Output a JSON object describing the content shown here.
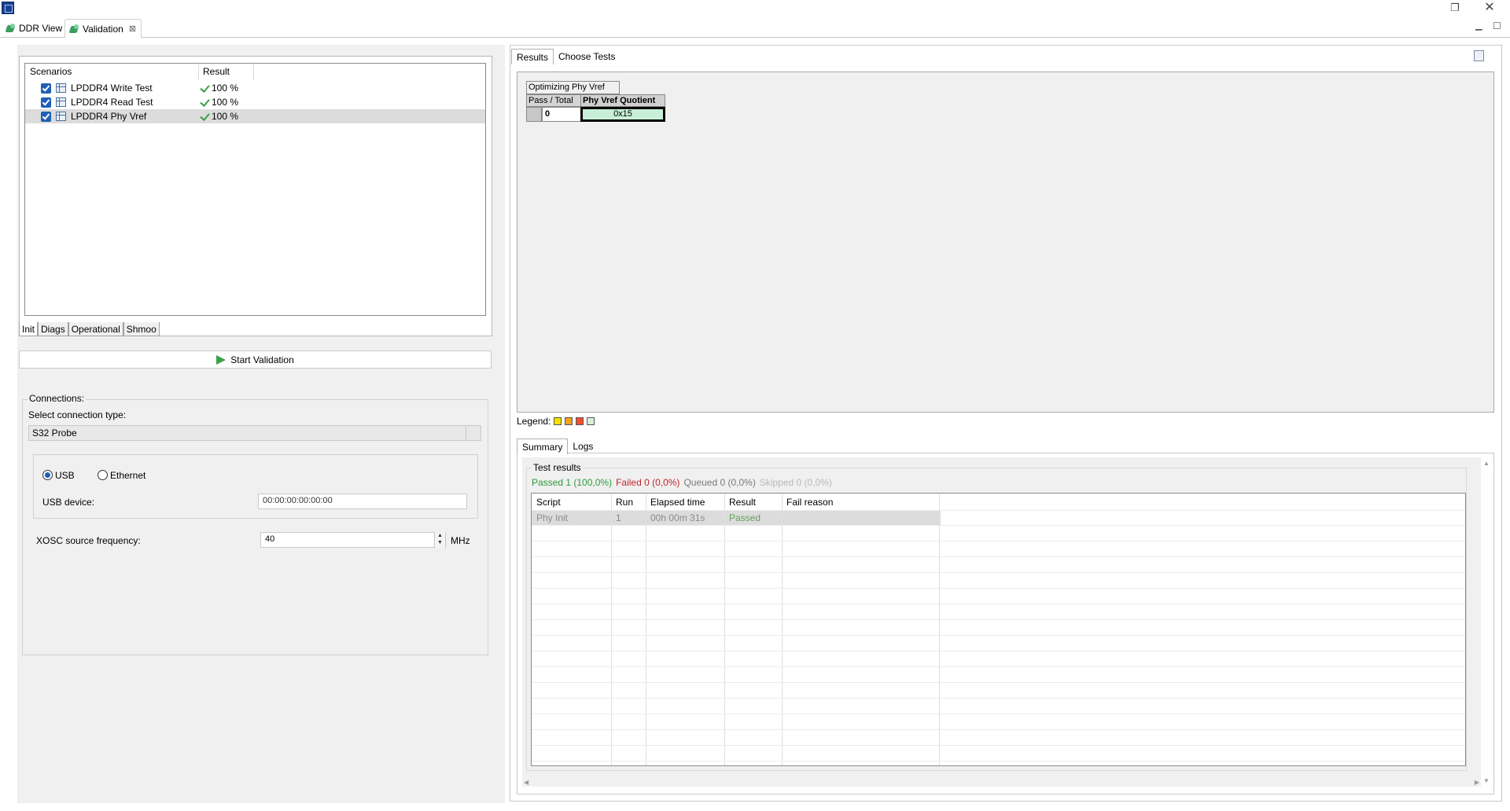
{
  "editor_tabs": [
    {
      "label": "DDR View"
    },
    {
      "label": "Validation"
    }
  ],
  "scenarios": {
    "headers": {
      "scenarios": "Scenarios",
      "result": "Result"
    },
    "rows": [
      {
        "name": "LPDDR4 Write Test",
        "result": "100 %"
      },
      {
        "name": "LPDDR4 Read Test",
        "result": "100 %"
      },
      {
        "name": "LPDDR4 Phy Vref",
        "result": "100 %"
      }
    ]
  },
  "bottom_tabs": [
    "Init",
    "Diags",
    "Operational",
    "Shmoo"
  ],
  "start_button": "Start Validation",
  "connections": {
    "legend": "Connections:",
    "select_label": "Select connection type:",
    "type": "S32 Probe",
    "usb": "USB",
    "ethernet": "Ethernet",
    "usb_device_label": "USB device:",
    "usb_device_value": "00:00:00:00:00:00",
    "xosc_label": "XOSC source frequency:",
    "xosc_value": "40",
    "xosc_unit": "MHz"
  },
  "results_tabs": [
    "Results",
    "Choose Tests"
  ],
  "result_table": {
    "title": "Optimizing Phy Vref",
    "pass_total_label": "Pass / Total",
    "quotient_label": "Phy Vref Quotient",
    "pass_value": "0",
    "quotient_value": "0x15"
  },
  "legend": {
    "label": "Legend:",
    "colors": [
      "#f5e000",
      "#f5a020",
      "#f05030",
      "#d8f0d8"
    ]
  },
  "summary_tabs": [
    "Summary",
    "Logs"
  ],
  "test_results": {
    "legend": "Test results",
    "passed": "Passed 1 (100,0%)",
    "failed": "Failed 0 (0,0%)",
    "queued": "Queued 0 (0,0%)",
    "skipped": "Skipped 0 (0,0%)",
    "columns": [
      "Script",
      "Run",
      "Elapsed time",
      "Result",
      "Fail reason"
    ],
    "rows": [
      {
        "script": "Phy Init",
        "run": "1",
        "elapsed": "00h 00m 31s",
        "result": "Passed",
        "fail": ""
      }
    ]
  }
}
